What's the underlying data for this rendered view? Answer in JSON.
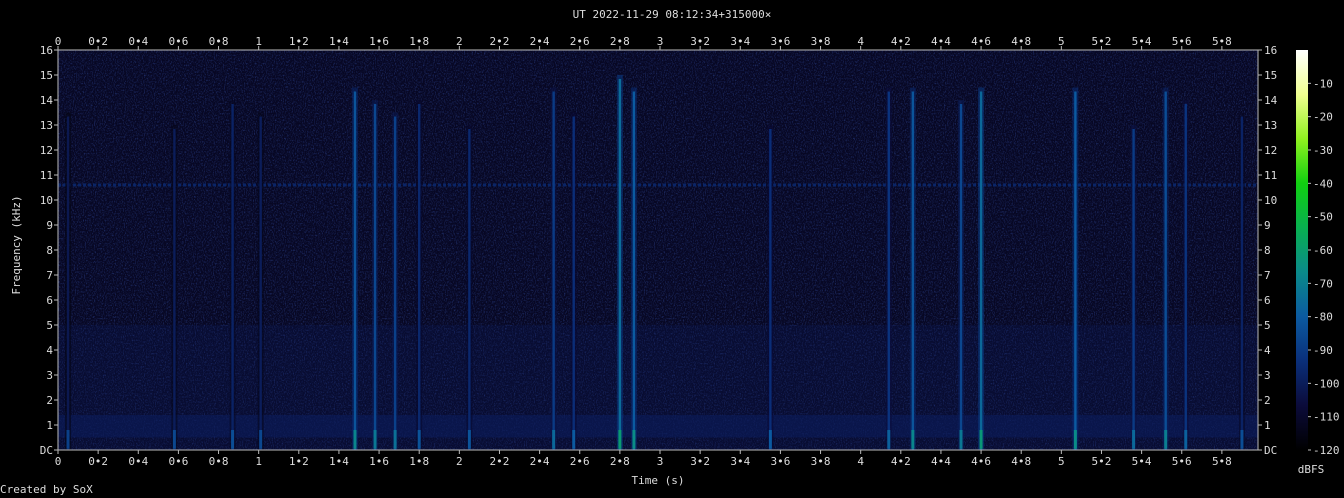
{
  "chart_data": {
    "type": "heatmap",
    "title": "UT 2022-11-29 08:12:34+315000×",
    "xlabel": "Time (s)",
    "ylabel": "Frequency (kHz)",
    "x_range": [
      0,
      5.98
    ],
    "y_range": [
      0,
      16
    ],
    "x_ticks": [
      "0",
      "0•2",
      "0•4",
      "0•6",
      "0•8",
      "1",
      "1•2",
      "1•4",
      "1•6",
      "1•8",
      "2",
      "2•2",
      "2•4",
      "2•6",
      "2•8",
      "3",
      "3•2",
      "3•4",
      "3•6",
      "3•8",
      "4",
      "4•2",
      "4•4",
      "4•6",
      "4•8",
      "5",
      "5•2",
      "5•4",
      "5•6",
      "5•8"
    ],
    "y_ticks": [
      "DC",
      "1",
      "2",
      "3",
      "4",
      "5",
      "6",
      "7",
      "8",
      "9",
      "10",
      "11",
      "12",
      "13",
      "14",
      "15",
      "16"
    ],
    "colorbar": {
      "label": "dBFS",
      "range": [
        -120,
        0
      ],
      "ticks": [
        "-10",
        "-20",
        "-30",
        "-40",
        "-50",
        "-60",
        "-70",
        "-80",
        "-90",
        "-100",
        "-110",
        "-120"
      ],
      "stops": [
        "#000000",
        "#0b0b3a",
        "#0a2f7a",
        "#0b5aa0",
        "#0a8a8a",
        "#08b050",
        "#10d010",
        "#90f020",
        "#f0ff90",
        "#ffffff"
      ]
    },
    "background_level": -112,
    "features": {
      "tone_kHz": 10.6,
      "tone_level": -96,
      "low_band_kHz": [
        0.5,
        1.4
      ],
      "low_band_level": -100,
      "transients": [
        {
          "t": 0.05,
          "f_top": 13.5,
          "level": -102
        },
        {
          "t": 0.58,
          "f_top": 13.0,
          "level": -100
        },
        {
          "t": 0.87,
          "f_top": 14.0,
          "level": -98
        },
        {
          "t": 1.01,
          "f_top": 13.5,
          "level": -100
        },
        {
          "t": 1.48,
          "f_top": 14.5,
          "level": -82
        },
        {
          "t": 1.58,
          "f_top": 14.0,
          "level": -86
        },
        {
          "t": 1.68,
          "f_top": 13.5,
          "level": -88
        },
        {
          "t": 1.8,
          "f_top": 14.0,
          "level": -96
        },
        {
          "t": 2.05,
          "f_top": 13.0,
          "level": -96
        },
        {
          "t": 2.47,
          "f_top": 14.5,
          "level": -90
        },
        {
          "t": 2.57,
          "f_top": 13.5,
          "level": -94
        },
        {
          "t": 2.8,
          "f_top": 15.0,
          "level": -75
        },
        {
          "t": 2.87,
          "f_top": 14.5,
          "level": -80
        },
        {
          "t": 3.55,
          "f_top": 13.0,
          "level": -94
        },
        {
          "t": 4.14,
          "f_top": 14.5,
          "level": -92
        },
        {
          "t": 4.26,
          "f_top": 14.5,
          "level": -82
        },
        {
          "t": 4.5,
          "f_top": 14.0,
          "level": -86
        },
        {
          "t": 4.6,
          "f_top": 14.5,
          "level": -76
        },
        {
          "t": 5.07,
          "f_top": 14.5,
          "level": -80
        },
        {
          "t": 5.36,
          "f_top": 13.0,
          "level": -90
        },
        {
          "t": 5.52,
          "f_top": 14.5,
          "level": -84
        },
        {
          "t": 5.62,
          "f_top": 14.0,
          "level": -92
        },
        {
          "t": 5.9,
          "f_top": 13.5,
          "level": -98
        }
      ]
    }
  },
  "footer": {
    "credit": "Created by SoX"
  }
}
